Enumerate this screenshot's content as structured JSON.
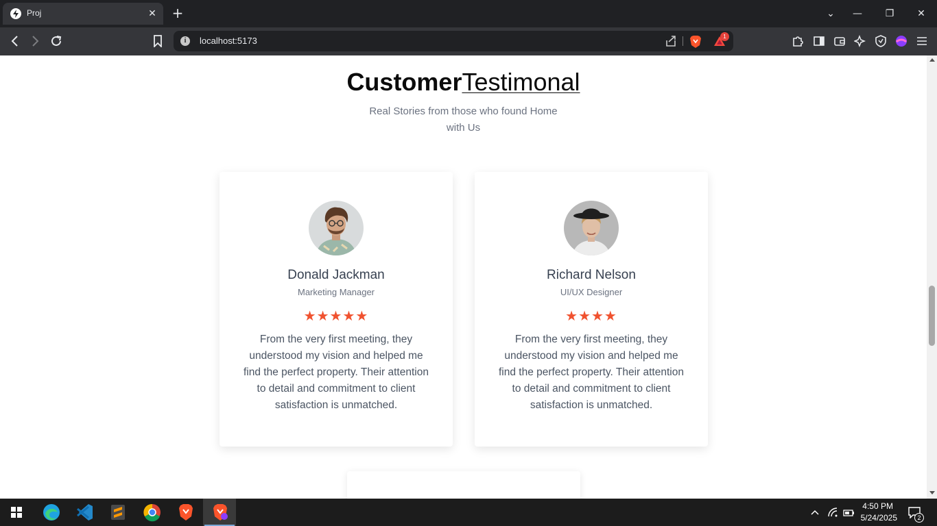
{
  "browser": {
    "tab_title": "Proj",
    "url": "localhost:5173",
    "notification_count": "1"
  },
  "page": {
    "heading_bold": "Customer",
    "heading_light": "Testimonal",
    "subtitle": "Real Stories from those who found Home with Us",
    "testimonials": [
      {
        "name": "Donald Jackman",
        "role": "Marketing Manager",
        "rating": 5,
        "stars": "★★★★★",
        "text": "From the very first meeting, they understood my vision and helped me find the perfect property. Their attention to detail and commitment to client satisfaction is unmatched."
      },
      {
        "name": "Richard Nelson",
        "role": "UI/UX Designer",
        "rating": 4,
        "stars": "★★★★",
        "text": "From the very first meeting, they understood my vision and helped me find the perfect property. Their attention to detail and commitment to client satisfaction is unmatched."
      }
    ]
  },
  "taskbar": {
    "time": "4:50 PM",
    "date": "5/24/2025",
    "notification_count": "2"
  },
  "colors": {
    "star": "#f0522f",
    "heading": "#0b0b0b",
    "muted_text": "#6b7280"
  }
}
